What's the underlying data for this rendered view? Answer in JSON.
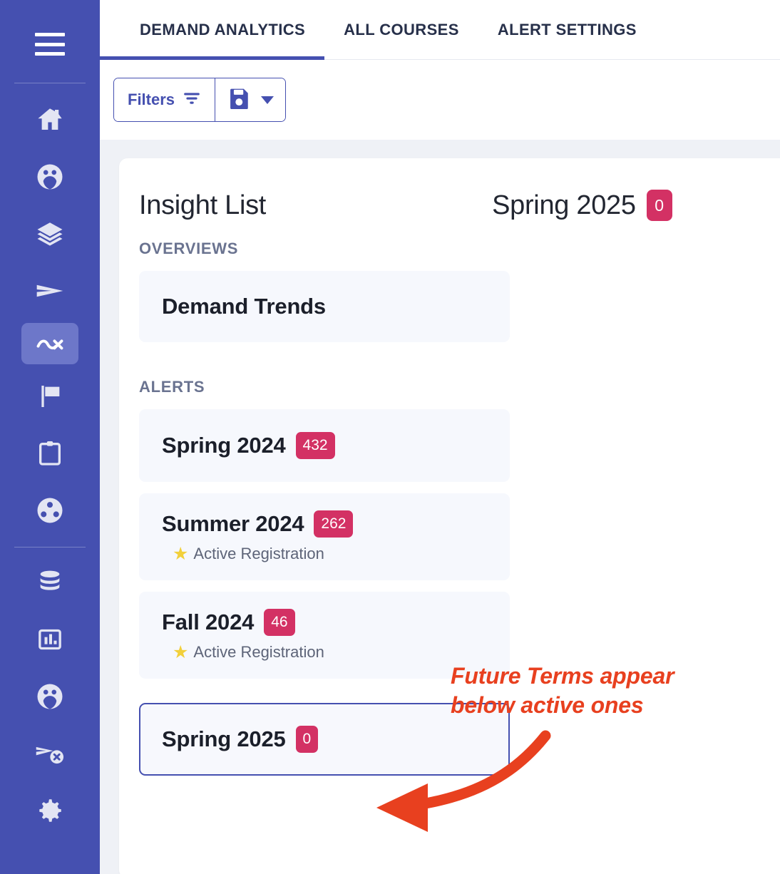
{
  "sidebar": {
    "menu_icon": "hamburger-menu-icon",
    "items": [
      {
        "icon": "home-icon",
        "name": "home",
        "active": false
      },
      {
        "icon": "people-circle-icon",
        "name": "people",
        "active": false
      },
      {
        "icon": "layers-icon",
        "name": "layers",
        "active": false
      },
      {
        "icon": "send-icon",
        "name": "send",
        "active": false
      },
      {
        "icon": "trending-analytics-icon",
        "name": "analytics",
        "active": true
      },
      {
        "icon": "flag-icon",
        "name": "flag",
        "active": false
      },
      {
        "icon": "clipboard-icon",
        "name": "clipboard",
        "active": false
      },
      {
        "icon": "group-circle-icon",
        "name": "group",
        "active": false
      },
      {
        "icon": "database-icon",
        "name": "database",
        "active": false
      },
      {
        "icon": "bar-chart-icon",
        "name": "reports",
        "active": false
      },
      {
        "icon": "people-circle-icon",
        "name": "contacts",
        "active": false
      },
      {
        "icon": "send-cancel-icon",
        "name": "unsent",
        "active": false
      },
      {
        "icon": "gear-icon",
        "name": "settings",
        "active": false
      }
    ]
  },
  "tabs": [
    {
      "label": "DEMAND ANALYTICS",
      "active": true
    },
    {
      "label": "ALL COURSES",
      "active": false
    },
    {
      "label": "ALERT SETTINGS",
      "active": false
    }
  ],
  "toolbar": {
    "filters_label": "Filters",
    "filter_icon": "filter-funnel-icon",
    "save_icon": "save-floppy-icon",
    "dropdown_icon": "caret-down-icon"
  },
  "card": {
    "title": "Insight List",
    "selected_term": "Spring 2025",
    "selected_term_count": "0",
    "sections": [
      {
        "label": "OVERVIEWS",
        "items": [
          {
            "title": "Demand Trends",
            "count": null,
            "sub": null,
            "selected": false
          }
        ]
      },
      {
        "label": "ALERTS",
        "items": [
          {
            "title": "Spring 2024",
            "count": "432",
            "sub": null,
            "selected": false
          },
          {
            "title": "Summer 2024",
            "count": "262",
            "sub": "Active Registration",
            "selected": false
          },
          {
            "title": "Fall 2024",
            "count": "46",
            "sub": "Active Registration",
            "selected": false
          },
          {
            "title": "Spring 2025",
            "count": "0",
            "sub": null,
            "selected": true
          }
        ]
      }
    ],
    "sub_icon": "star-icon"
  },
  "annotation": {
    "text_line_1": "Future Terms appear",
    "text_line_2": "below active ones",
    "arrow_icon": "curved-arrow-left-icon",
    "color": "#e8401f"
  },
  "colors": {
    "sidebar": "#4550b0",
    "accent": "#4550b0",
    "badge": "#d33164",
    "annotation": "#e8401f",
    "star": "#f2d03b"
  }
}
